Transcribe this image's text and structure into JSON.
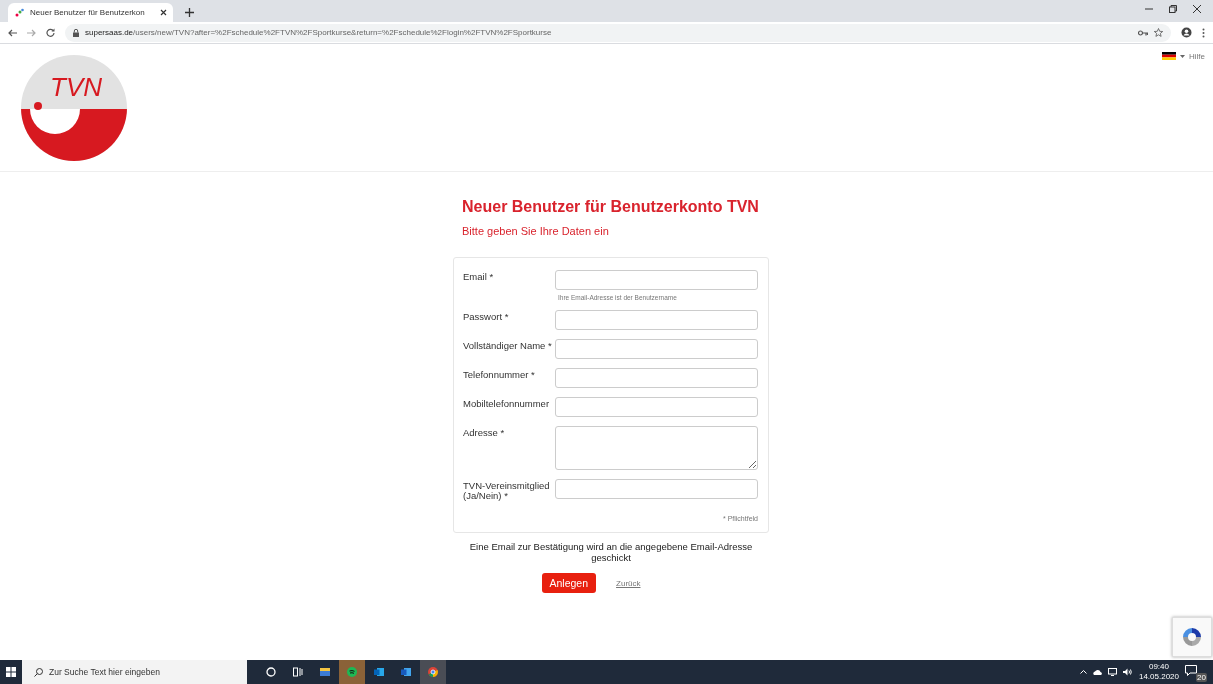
{
  "browser": {
    "tabs": [
      {
        "title": "Neuer Benutzer für Benutzerkon",
        "selected": true
      }
    ],
    "url_host": "supersaas.de",
    "url_path": "/users/new/TVN?after=%2Fschedule%2FTVN%2FSportkurse&return=%2Fschedule%2Flogin%2FTVN%2FSportkurse"
  },
  "header": {
    "logo_text": "TVN",
    "help_link": "Hilfe"
  },
  "title": "Neuer Benutzer für Benutzerkonto TVN",
  "subtitle": "Bitte geben Sie Ihre Daten ein",
  "fields": [
    {
      "label": "Email *",
      "kind": "input",
      "hint": "Ihre Email-Adresse ist der Benutzername"
    },
    {
      "label": "Passwort *",
      "kind": "input"
    },
    {
      "label": "Vollständiger Name *",
      "kind": "input"
    },
    {
      "label": "Telefonnummer *",
      "kind": "input"
    },
    {
      "label": "Mobiltelefonnummer",
      "kind": "input"
    },
    {
      "label": "Adresse *",
      "kind": "textarea"
    },
    {
      "label": "TVN-Vereinsmitglied (Ja/Nein) *",
      "kind": "input"
    }
  ],
  "required_note": "* Pflichtfeld",
  "confirmation_note": "Eine Email zur Bestätigung wird an die angegebene Email-Adresse geschickt",
  "submit_button": "Anlegen",
  "back_link": "Zurück",
  "taskbar": {
    "search_placeholder": "Zur Suche Text hier eingeben",
    "apps": [
      {
        "kind": "cortana",
        "selected": false
      },
      {
        "kind": "taskview",
        "selected": false
      },
      {
        "kind": "explorer",
        "selected": false
      },
      {
        "kind": "spotify",
        "selected": true
      },
      {
        "kind": "outlook",
        "selected": false
      },
      {
        "kind": "word",
        "selected": false
      },
      {
        "kind": "chrome",
        "selected": true
      }
    ],
    "time": "09:40",
    "date": "14.05.2020",
    "notifications": "20"
  }
}
